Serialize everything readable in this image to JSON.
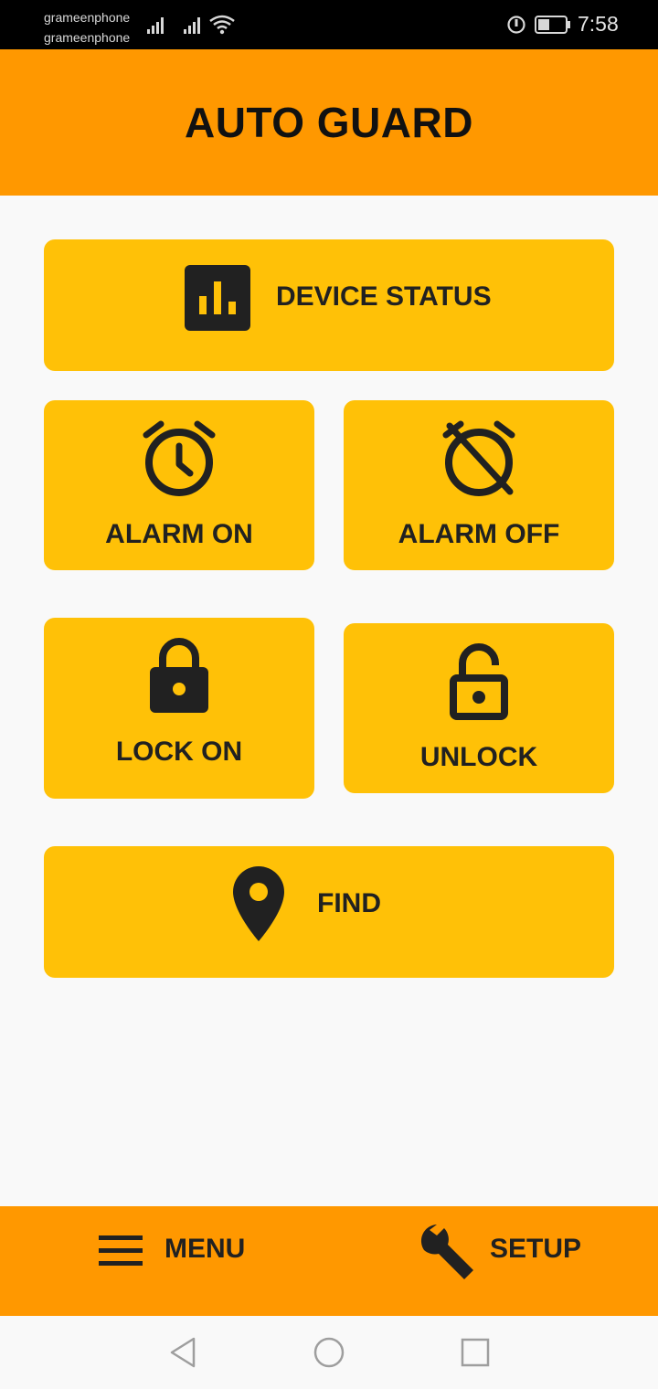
{
  "status_bar": {
    "carrier_1": "grameenphone",
    "carrier_2": "grameenphone",
    "time": "7:58",
    "icons": [
      "signal-icon",
      "signal-icon",
      "wifi-icon",
      "do-not-disturb-icon",
      "battery-icon"
    ]
  },
  "app_bar": {
    "title": "AUTO GUARD"
  },
  "tiles": {
    "device_status": {
      "label": "DEVICE STATUS",
      "icon": "bar-chart-icon"
    },
    "alarm_on": {
      "label": "ALARM ON",
      "icon": "alarm-clock-icon"
    },
    "alarm_off": {
      "label": "ALARM OFF",
      "icon": "alarm-off-icon"
    },
    "lock_on": {
      "label": "LOCK ON",
      "icon": "lock-icon"
    },
    "unlock": {
      "label": "UNLOCK",
      "icon": "lock-open-icon"
    },
    "find": {
      "label": "FIND",
      "icon": "location-pin-icon"
    }
  },
  "bottom_bar": {
    "menu": {
      "label": "MENU",
      "icon": "hamburger-menu-icon"
    },
    "setup": {
      "label": "SETUP",
      "icon": "wrench-icon"
    }
  },
  "nav_bar": {
    "icons": [
      "back-icon",
      "home-icon",
      "recents-icon"
    ]
  },
  "colors": {
    "app_bar": "#ff9800",
    "tile": "#ffc107",
    "text_dark": "#212121",
    "background": "#f9f9f9"
  }
}
